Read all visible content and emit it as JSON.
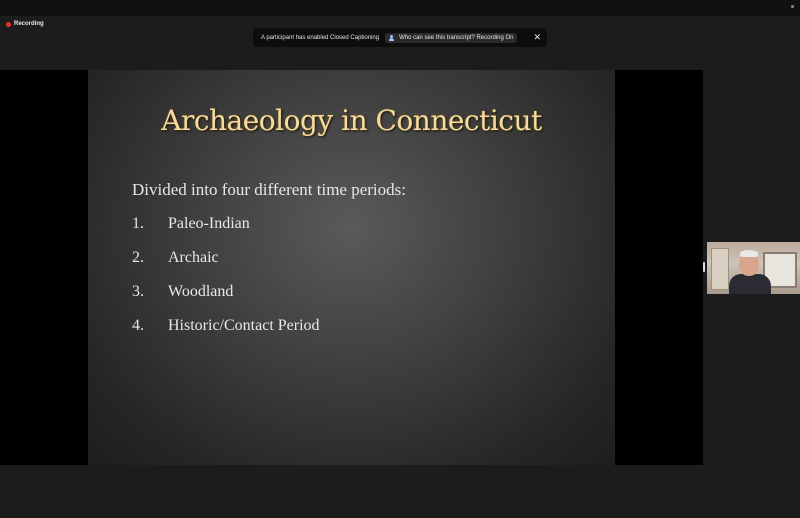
{
  "recording": {
    "label": "Recording"
  },
  "banner": {
    "message": "A participant has enabled Closed Captioning",
    "link": "Who can see this transcript? Recording On",
    "icon": "people-icon",
    "close_icon": "close-icon"
  },
  "slide": {
    "title": "Archaeology in Connecticut",
    "intro": "Divided into four different time periods:",
    "items": [
      {
        "num": "1.",
        "text": "Paleo-Indian"
      },
      {
        "num": "2.",
        "text": "Archaic"
      },
      {
        "num": "3.",
        "text": "Woodland"
      },
      {
        "num": "4.",
        "text": "Historic/Contact Period"
      }
    ]
  },
  "colors": {
    "title": "#f4dca0",
    "recording_dot": "#e0352b",
    "background": "#1c1c1c"
  }
}
